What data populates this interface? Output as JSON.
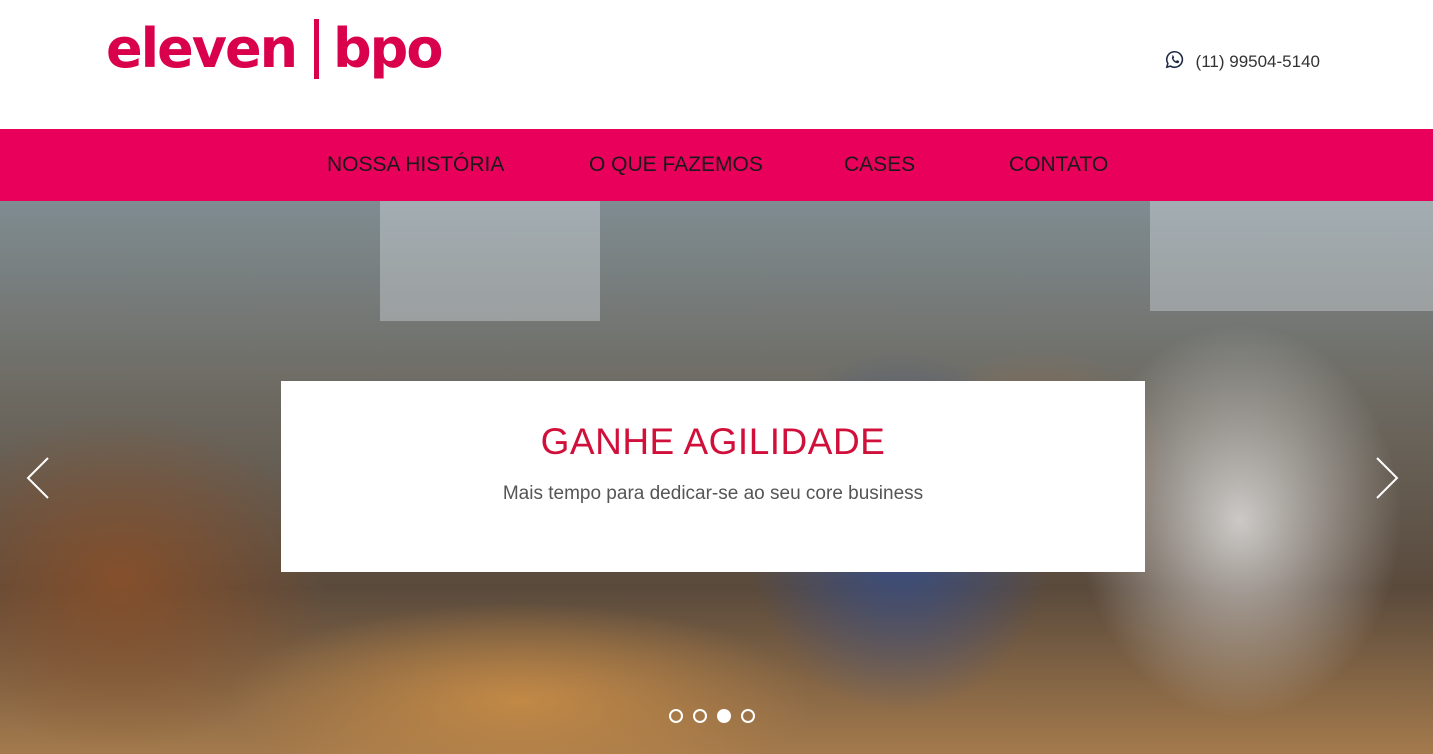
{
  "brand": {
    "logo_left": "eleven",
    "logo_right": "bpo",
    "accent_color": "#e8005a",
    "logo_color": "#d9004c"
  },
  "header": {
    "phone_icon": "whatsapp-icon",
    "phone": "(11) 99504-5140"
  },
  "nav": {
    "items": [
      {
        "label": "NOSSA HISTÓRIA"
      },
      {
        "label": "O QUE FAZEMOS"
      },
      {
        "label": "CASES"
      },
      {
        "label": "CONTATO"
      }
    ]
  },
  "carousel": {
    "title": "GANHE AGILIDADE",
    "subtitle": "Mais tempo para dedicar-se ao seu core business",
    "prev_icon": "chevron-left-icon",
    "next_icon": "chevron-right-icon",
    "slide_count": 4,
    "active_index": 3
  }
}
